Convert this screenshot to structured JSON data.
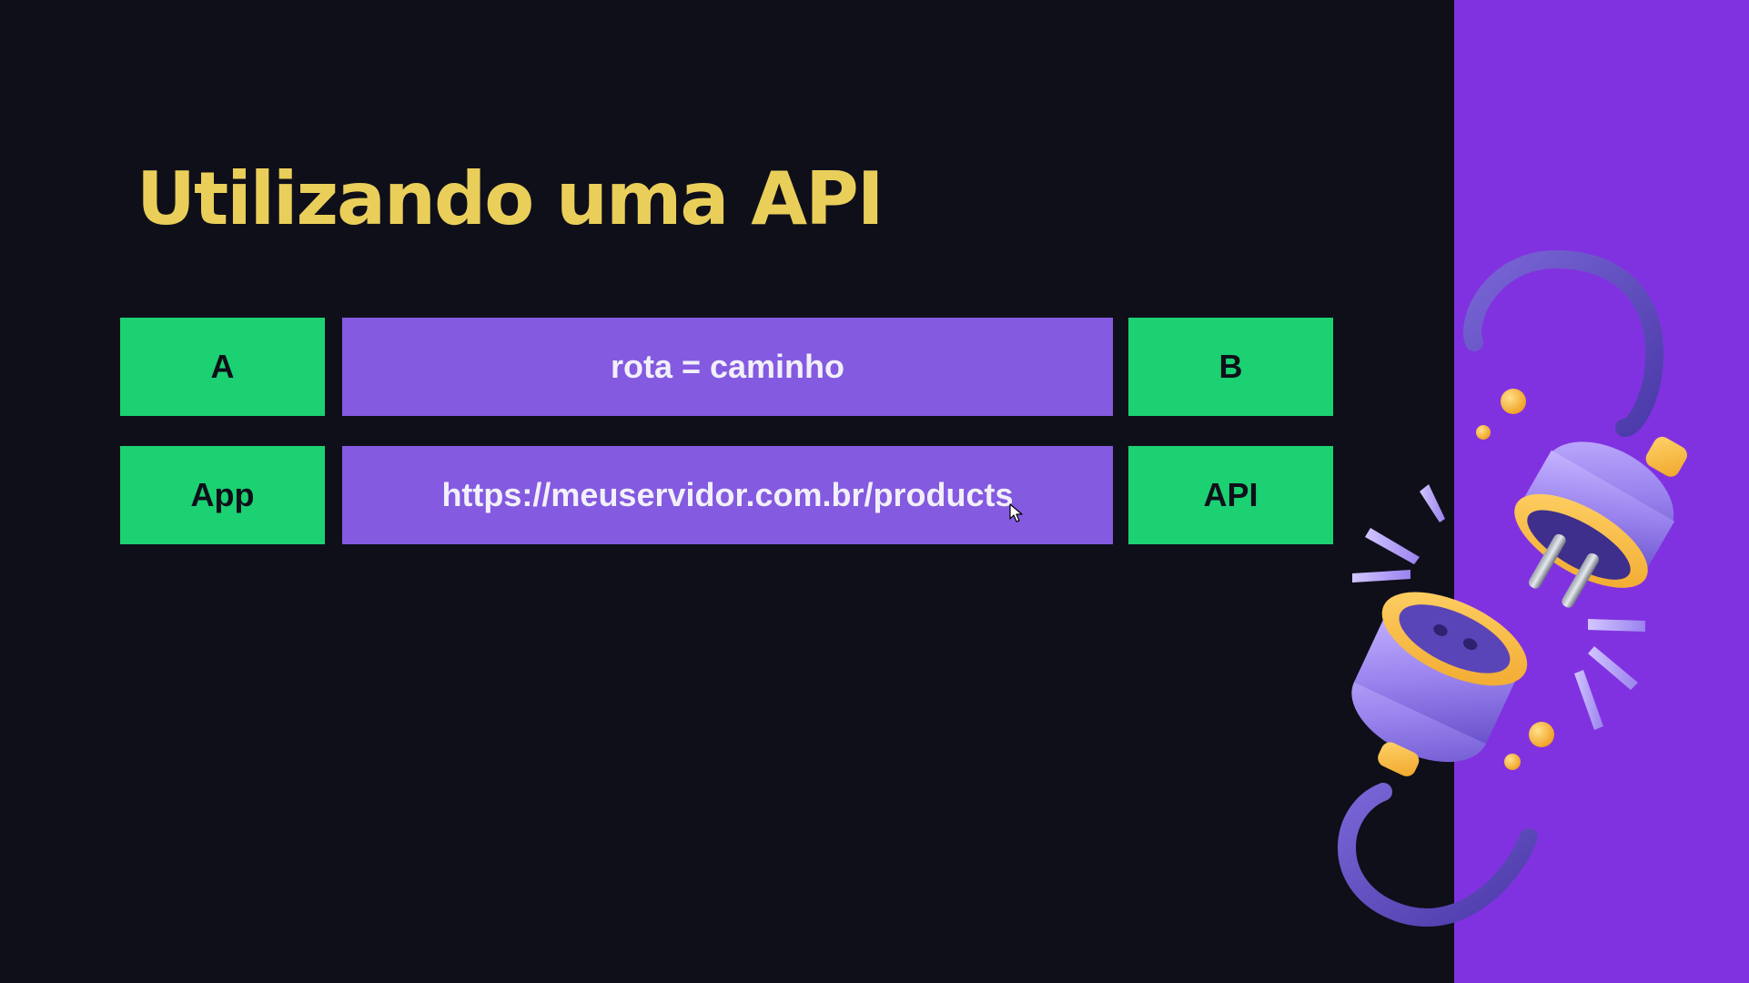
{
  "slide": {
    "title": "Utilizando uma API",
    "rows": [
      {
        "left": "A",
        "middle": "rota = caminho",
        "right": "B"
      },
      {
        "left": "App",
        "middle": "https://meuservidor.com.br/products",
        "right": "API"
      }
    ]
  },
  "colors": {
    "background": "#0f0f1a",
    "side_panel": "#8132e0",
    "title": "#e9cf5a",
    "green_box": "#1bd172",
    "purple_box": "#845ae0"
  },
  "icons": {
    "illustration": "unplugged-cable-icon",
    "cursor": "mouse-pointer-icon"
  }
}
